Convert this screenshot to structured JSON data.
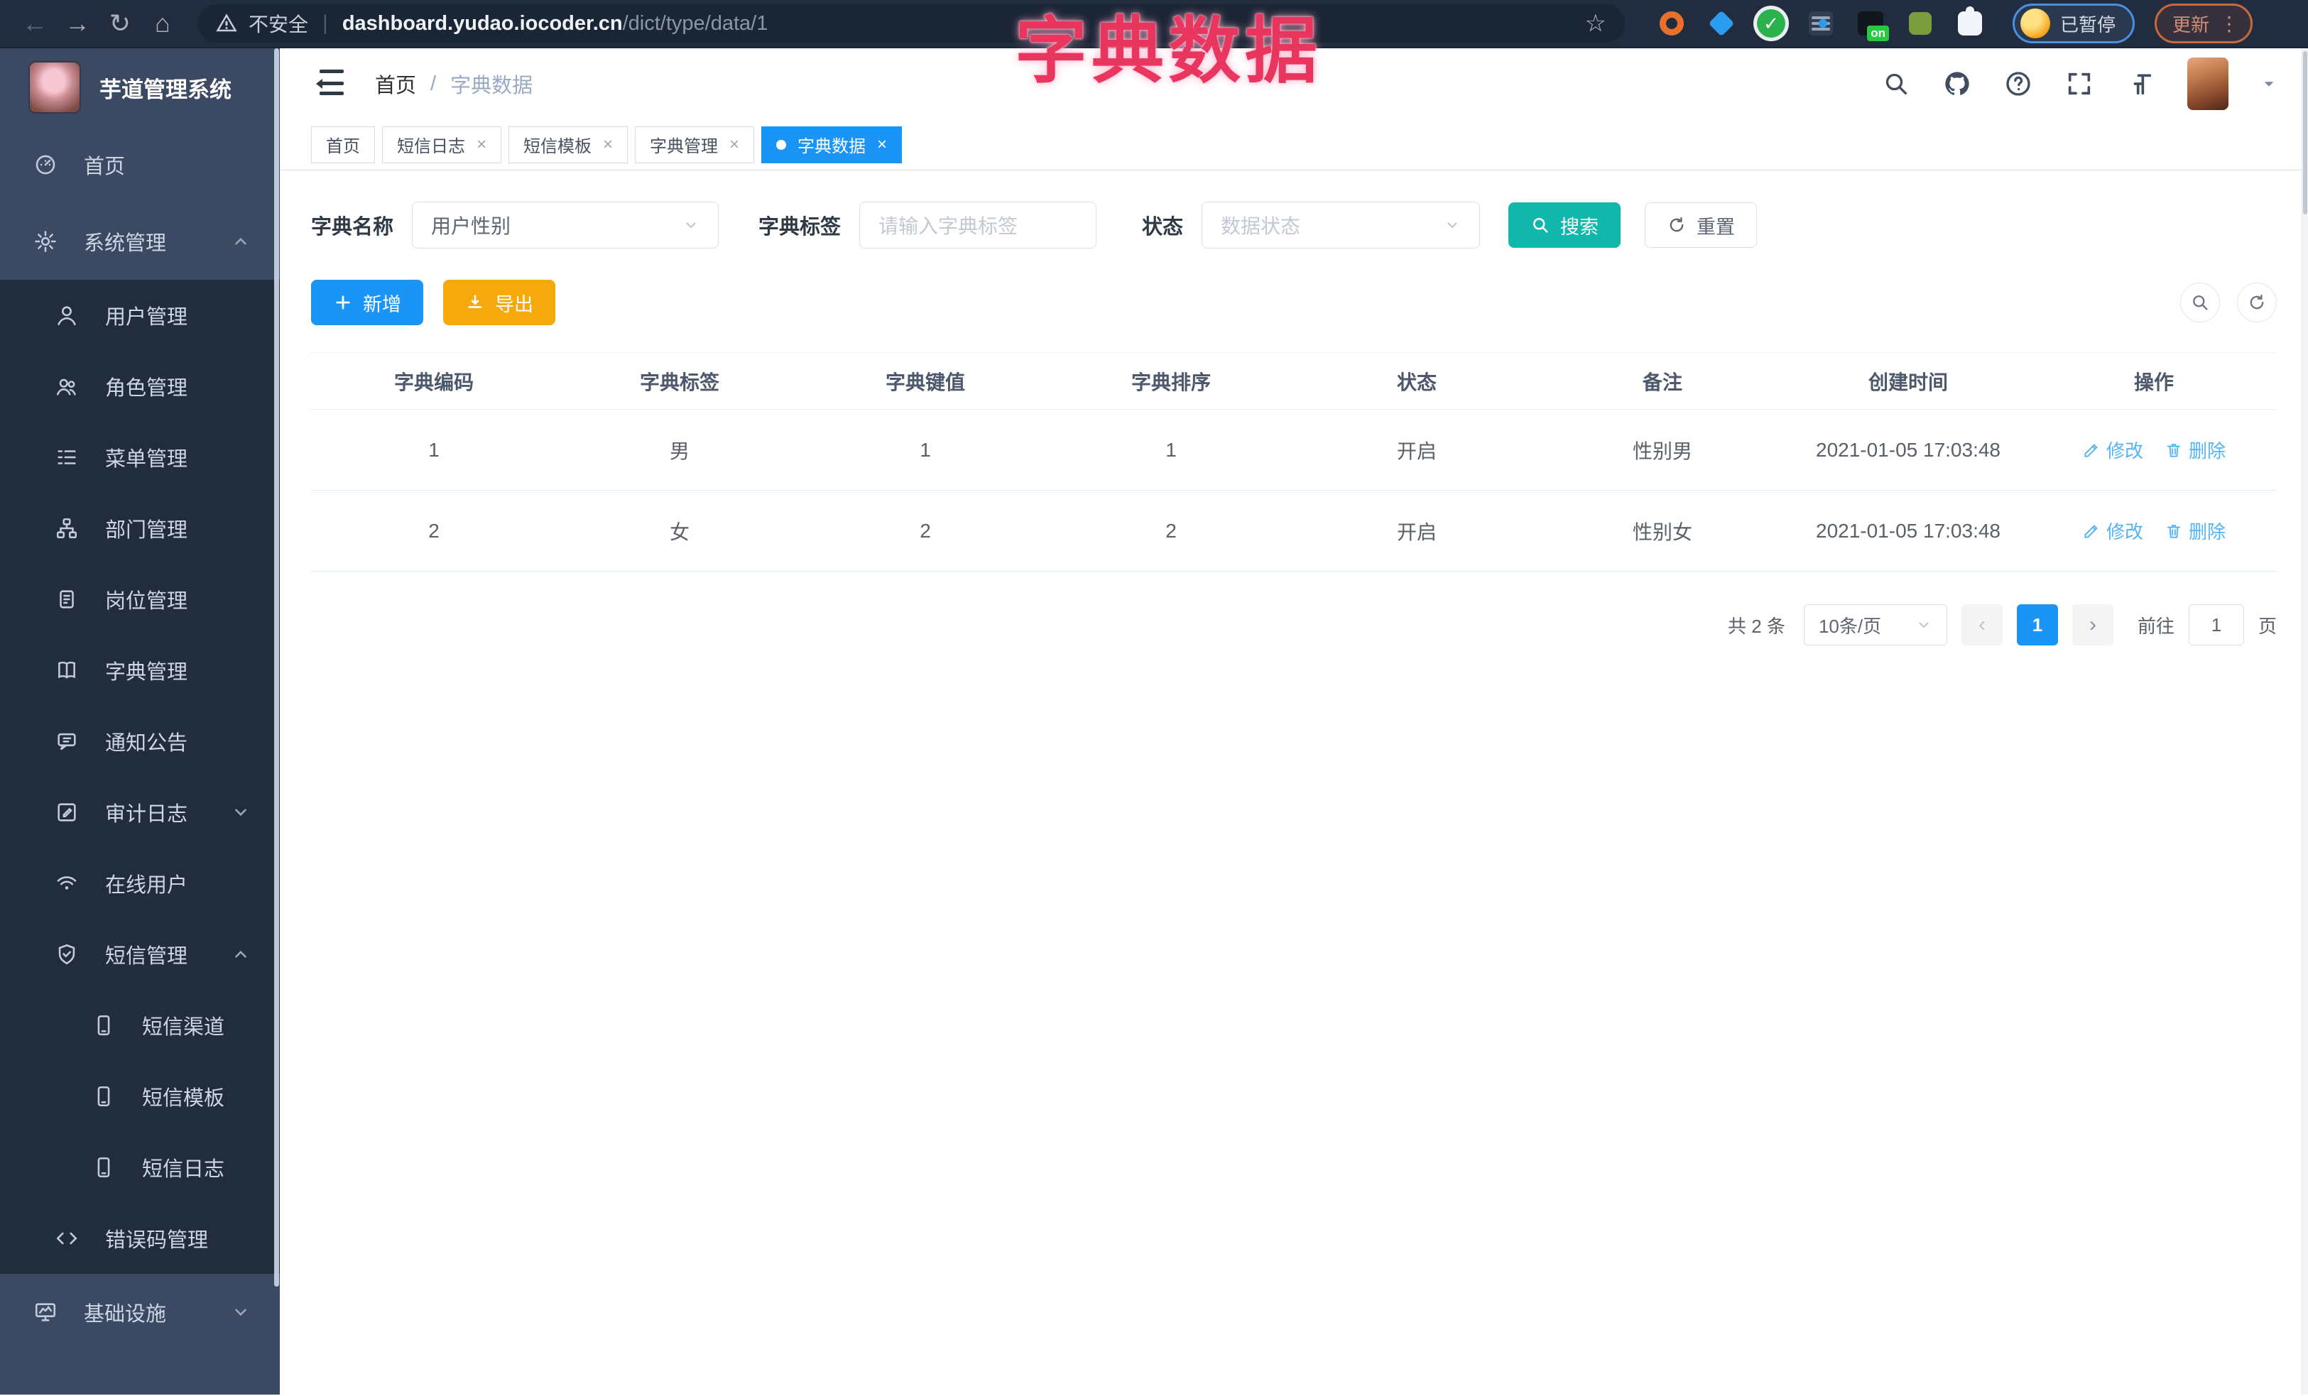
{
  "browser": {
    "back_glyph": "←",
    "forward_glyph": "→",
    "reload_glyph": "↻",
    "home_glyph": "⌂",
    "security_label": "不安全",
    "url_separator": "|",
    "url_domain": "dashboard.yudao.iocoder.cn",
    "url_path": "/dict/type/data/1",
    "star_glyph": "☆",
    "extension_badge": "on",
    "check_glyph": "✓",
    "profile_label": "已暂停",
    "update_label": "更新",
    "menu_dots": "⋮"
  },
  "overlay_title": "字典数据",
  "sidebar": {
    "app_title": "芋道管理系统",
    "items": [
      {
        "label": "首页",
        "icon": "dashboard-icon",
        "level": "top",
        "chevron": null
      },
      {
        "label": "系统管理",
        "icon": "gear-icon",
        "level": "top",
        "chevron": "up"
      },
      {
        "label": "用户管理",
        "icon": "user-icon",
        "level": "sub",
        "chevron": null
      },
      {
        "label": "角色管理",
        "icon": "users-icon",
        "level": "sub",
        "chevron": null
      },
      {
        "label": "菜单管理",
        "icon": "menu-list-icon",
        "level": "sub",
        "chevron": null
      },
      {
        "label": "部门管理",
        "icon": "org-tree-icon",
        "level": "sub",
        "chevron": null
      },
      {
        "label": "岗位管理",
        "icon": "badge-icon",
        "level": "sub",
        "chevron": null
      },
      {
        "label": "字典管理",
        "icon": "book-icon",
        "level": "sub",
        "chevron": null
      },
      {
        "label": "通知公告",
        "icon": "announcement-icon",
        "level": "sub",
        "chevron": null
      },
      {
        "label": "审计日志",
        "icon": "audit-log-icon",
        "level": "sub",
        "chevron": "down"
      },
      {
        "label": "在线用户",
        "icon": "online-users-icon",
        "level": "sub",
        "chevron": null
      },
      {
        "label": "短信管理",
        "icon": "shield-check-icon",
        "level": "sub",
        "chevron": "up"
      },
      {
        "label": "短信渠道",
        "icon": "phone-icon",
        "level": "sub2",
        "chevron": null
      },
      {
        "label": "短信模板",
        "icon": "phone-icon",
        "level": "sub2",
        "chevron": null
      },
      {
        "label": "短信日志",
        "icon": "phone-icon",
        "level": "sub2",
        "chevron": null
      },
      {
        "label": "错误码管理",
        "icon": "code-icon",
        "level": "sub",
        "chevron": null
      },
      {
        "label": "基础设施",
        "icon": "monitor-icon",
        "level": "top",
        "chevron": "down"
      }
    ]
  },
  "header": {
    "breadcrumb_home": "首页",
    "breadcrumb_separator": "/",
    "breadcrumb_current": "字典数据"
  },
  "tabs": {
    "close_glyph": "×",
    "items": [
      {
        "label": "首页",
        "closable": false,
        "active": false
      },
      {
        "label": "短信日志",
        "closable": true,
        "active": false
      },
      {
        "label": "短信模板",
        "closable": true,
        "active": false
      },
      {
        "label": "字典管理",
        "closable": true,
        "active": false
      },
      {
        "label": "字典数据",
        "closable": true,
        "active": true
      }
    ]
  },
  "filters": {
    "name_label": "字典名称",
    "name_value": "用户性别",
    "label_label": "字典标签",
    "label_placeholder": "请输入字典标签",
    "status_label": "状态",
    "status_placeholder": "数据状态",
    "search_label": "搜索",
    "reset_label": "重置"
  },
  "toolbar": {
    "add_label": "新增",
    "export_label": "导出"
  },
  "table": {
    "headers": [
      "字典编码",
      "字典标签",
      "字典键值",
      "字典排序",
      "状态",
      "备注",
      "创建时间",
      "操作"
    ],
    "rows": [
      [
        "1",
        "男",
        "1",
        "1",
        "开启",
        "性别男",
        "2021-01-05 17:03:48"
      ],
      [
        "2",
        "女",
        "2",
        "2",
        "开启",
        "性别女",
        "2021-01-05 17:03:48"
      ]
    ],
    "edit_label": "修改",
    "delete_label": "删除"
  },
  "pagination": {
    "total_text": "共 2 条",
    "page_size_value": "10条/页",
    "prev_glyph": "‹",
    "current_page": "1",
    "next_glyph": "›",
    "goto_label": "前往",
    "goto_value": "1",
    "page_unit_label": "页"
  },
  "colors": {
    "accent_blue": "#1a94f5",
    "search_teal": "#10b7aa",
    "export_orange": "#f6a90c",
    "overlay_pink": "#e8365f",
    "sidebar_bg": "#3b4962",
    "submenu_bg": "#212d3d",
    "browser_bar_bg": "#212d3f"
  }
}
